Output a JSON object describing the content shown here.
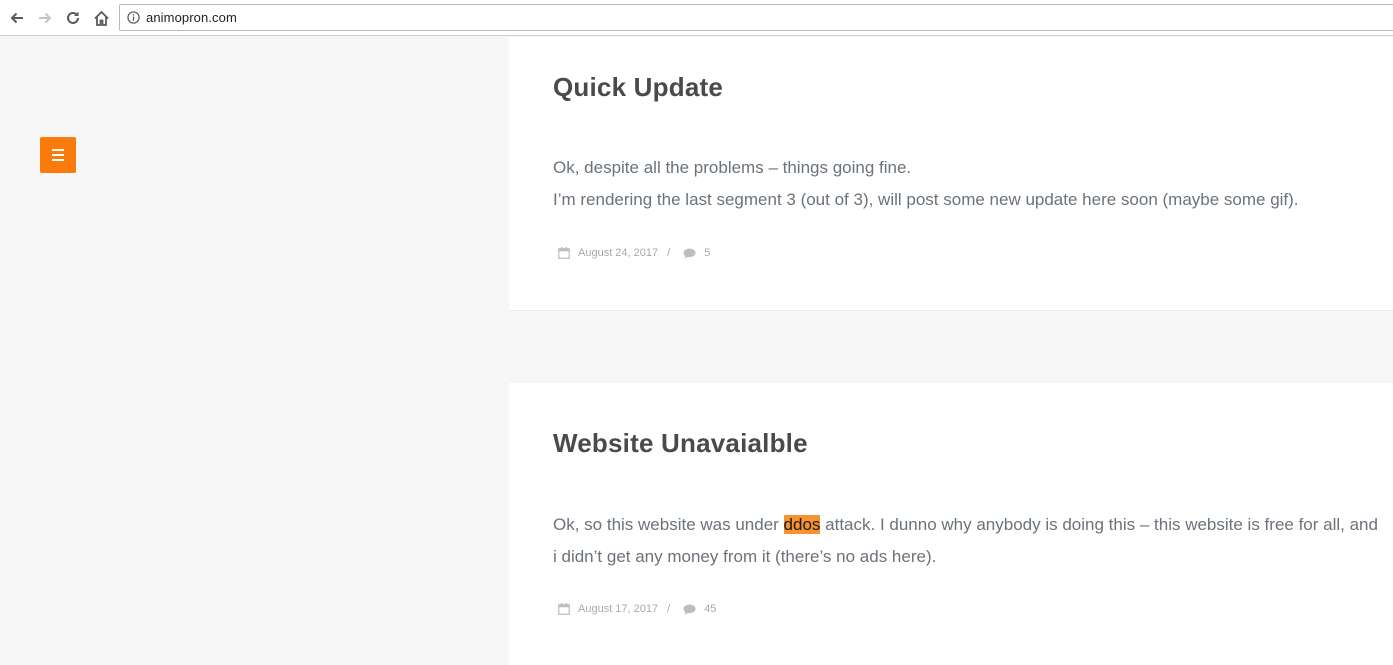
{
  "browser": {
    "url": "animopron.com",
    "icons": {
      "back": "arrow-left-icon",
      "forward": "arrow-right-icon",
      "reload": "reload-icon",
      "home": "home-icon",
      "site_info": "info-icon"
    }
  },
  "menu_button": {
    "icon": "hamburger-icon",
    "color": "#f97b0c"
  },
  "posts": [
    {
      "title": "Quick Update",
      "body_lines": [
        "Ok, despite all the problems – things going fine.",
        "I’m rendering the last segment 3 (out of 3), will post some new update here soon (maybe some gif)."
      ],
      "date": "August 24, 2017",
      "separator": "/",
      "comments": "5"
    },
    {
      "title": "Website Unavaialble",
      "body_before": "Ok, so this website was under ",
      "body_highlight": "ddos",
      "body_after": " attack. I dunno why anybody is doing this – this website is free for all, and i didn’t get any money from it (there’s no ads here).",
      "date": "August 17, 2017",
      "separator": "/",
      "comments": "45"
    }
  ],
  "colors": {
    "accent": "#f97b0c",
    "highlight": "#f7922e",
    "title": "#4a4a4a",
    "body": "#6b737a",
    "meta": "#a9a9a9",
    "page_bg": "#f6f6f6"
  }
}
